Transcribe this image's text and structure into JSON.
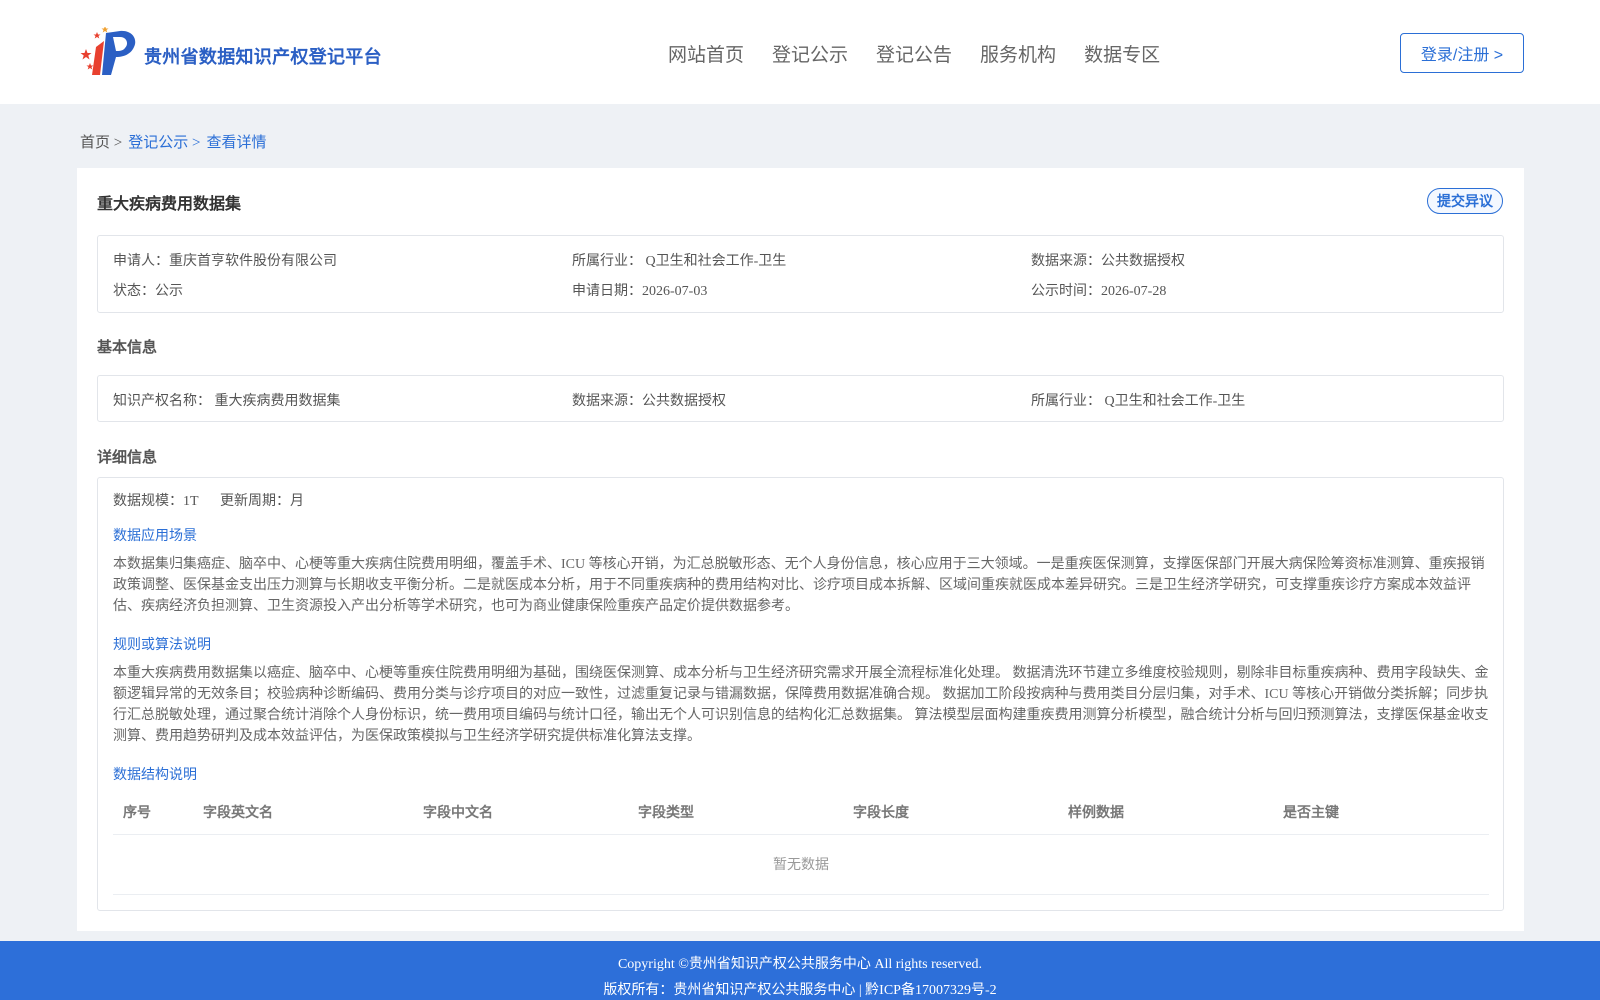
{
  "header": {
    "brand": "贵州省数据知识产权登记平台",
    "nav": [
      "网站首页",
      "登记公示",
      "登记公告",
      "服务机构",
      "数据专区"
    ],
    "login": "登录/注册 >"
  },
  "breadcrumb": {
    "home": "首页 >",
    "list": "登记公示 >",
    "current": "查看详情"
  },
  "record": {
    "title": "重大疾病费用数据集",
    "objection_button": "提交异议",
    "summary": {
      "applicant": "申请人：重庆首亨软件股份有限公司",
      "industry": "所属行业： Q卫生和社会工作-卫生",
      "source": "数据来源：公共数据授权",
      "status": "状态：公示",
      "apply_date": "申请日期：2026-07-03",
      "publish_date": "公示时间：2026-07-28"
    }
  },
  "basic": {
    "heading": "基本信息",
    "ip_name": "知识产权名称： 重大疾病费用数据集",
    "source": "数据来源：公共数据授权",
    "industry": "所属行业： Q卫生和社会工作-卫生"
  },
  "detail": {
    "heading": "详细信息",
    "scale": "数据规模：1T",
    "cycle": "更新周期：月",
    "scene_heading": "数据应用场景",
    "scene_text": "本数据集归集癌症、脑卒中、心梗等重大疾病住院费用明细，覆盖手术、ICU 等核心开销，为汇总脱敏形态、无个人身份信息，核心应用于三大领域。一是重疾医保测算，支撑医保部门开展大病保险筹资标准测算、重疾报销政策调整、医保基金支出压力测算与长期收支平衡分析。二是就医成本分析，用于不同重疾病种的费用结构对比、诊疗项目成本拆解、区域间重疾就医成本差异研究。三是卫生经济学研究，可支撑重疾诊疗方案成本效益评估、疾病经济负担测算、卫生资源投入产出分析等学术研究，也可为商业健康保险重疾产品定价提供数据参考。",
    "rule_heading": "规则或算法说明",
    "rule_text": "本重大疾病费用数据集以癌症、脑卒中、心梗等重疾住院费用明细为基础，围绕医保测算、成本分析与卫生经济研究需求开展全流程标准化处理。 数据清洗环节建立多维度校验规则，剔除非目标重疾病种、费用字段缺失、金额逻辑异常的无效条目；校验病种诊断编码、费用分类与诊疗项目的对应一致性，过滤重复记录与错漏数据，保障费用数据准确合规。 数据加工阶段按病种与费用类目分层归集，对手术、ICU 等核心开销做分类拆解；同步执行汇总脱敏处理，通过聚合统计消除个人身份标识，统一费用项目编码与统计口径，输出无个人可识别信息的结构化汇总数据集。 算法模型层面构建重疾费用测算分析模型，融合统计分析与回归预测算法，支撑医保基金收支测算、费用趋势研判及成本效益评估，为医保政策模拟与卫生经济学研究提供标准化算法支撑。",
    "structure_heading": "数据结构说明",
    "table_headers": [
      "序号",
      "字段英文名",
      "字段中文名",
      "字段类型",
      "字段长度",
      "样例数据",
      "是否主键"
    ],
    "empty_text": "暂无数据"
  },
  "footer": {
    "copyright": "Copyright ©贵州省知识产权公共服务中心 All rights reserved.",
    "owner": "版权所有：贵州省知识产权公共服务中心 | 黔ICP备17007329号-2"
  },
  "colors": {
    "accent": "#2b6fd6",
    "footer_bg": "#2d6fd9",
    "page_bg": "#eef1f5"
  }
}
